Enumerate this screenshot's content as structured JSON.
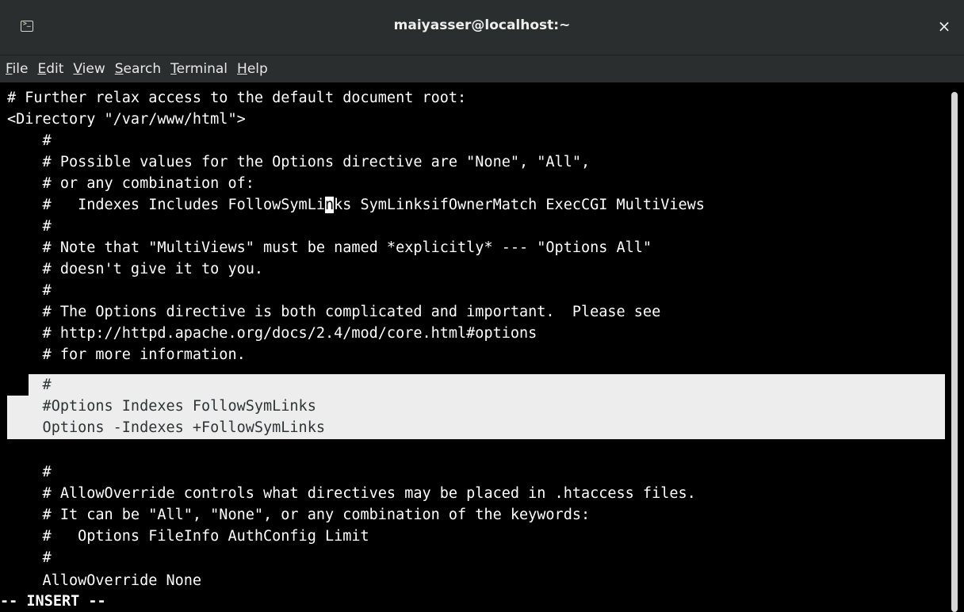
{
  "window": {
    "title": "maiyasser@localhost:~",
    "terminal_icon_glyph": ">_",
    "close_glyph": "×"
  },
  "menu": [
    {
      "accel": "F",
      "rest": "ile"
    },
    {
      "accel": "E",
      "rest": "dit"
    },
    {
      "accel": "V",
      "rest": "iew"
    },
    {
      "accel": "S",
      "rest": "earch"
    },
    {
      "accel": "T",
      "rest": "erminal"
    },
    {
      "accel": "H",
      "rest": "elp"
    }
  ],
  "editor": {
    "lines": [
      "# Further relax access to the default document root:",
      "<Directory \"/var/www/html\">",
      "    #",
      "    # Possible values for the Options directive are \"None\", \"All\",",
      "    # or any combination of:",
      "    #   Indexes Includes FollowSymLinks SymLinksifOwnerMatch ExecCGI MultiViews",
      "    #",
      "    # Note that \"MultiViews\" must be named *explicitly* --- \"Options All\"",
      "    # doesn't give it to you.",
      "    #",
      "    # The Options directive is both complicated and important.  Please see",
      "    # http://httpd.apache.org/docs/2.4/mod/core.html#options",
      "    # for more information.",
      "    #",
      "    #Options Indexes FollowSymLinks",
      "    Options -Indexes +FollowSymLinks",
      "",
      "    #",
      "    # AllowOverride controls what directives may be placed in .htaccess files.",
      "    # It can be \"All\", \"None\", or any combination of the keywords:",
      "    #   Options FileInfo AuthConfig Limit",
      "    #",
      "    AllowOverride None"
    ],
    "cursor_line": {
      "before": "    #   Indexes Includes FollowSymLi",
      "cursor_char": "n",
      "after": "ks SymLinksifOwnerMatch ExecCGI MultiViews"
    },
    "status_line": "-- INSERT --"
  }
}
